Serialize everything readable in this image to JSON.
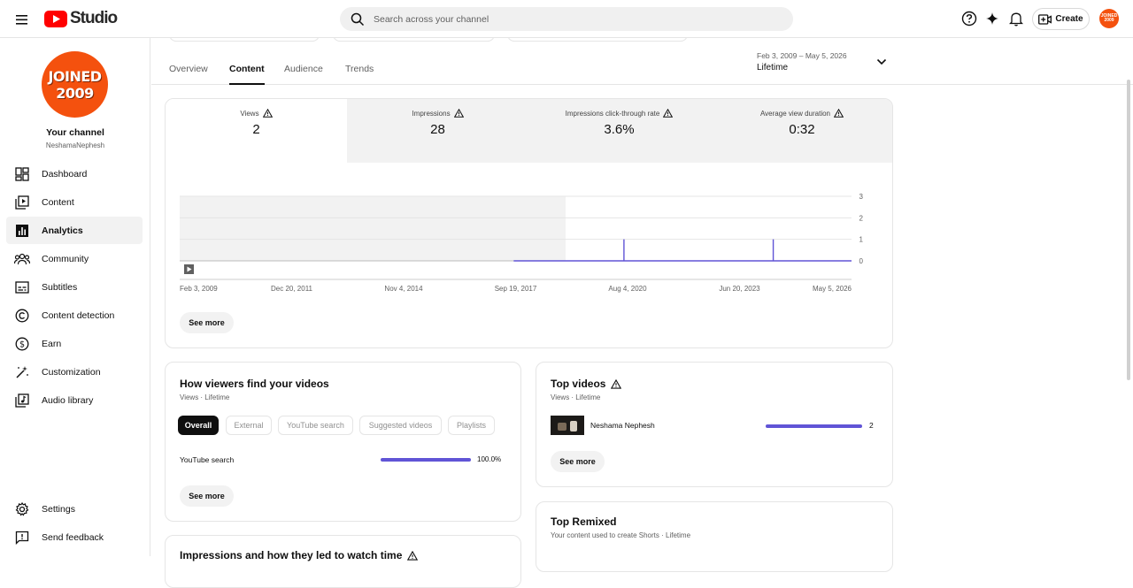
{
  "topbar": {
    "logo_text": "Studio",
    "search_placeholder": "Search across your channel",
    "create_label": "Create",
    "avatar_text": "JOINED 2009"
  },
  "sidebar": {
    "avatar_line1": "JOINED",
    "avatar_line2": "2009",
    "channel_title": "Your channel",
    "channel_handle": "NeshamaNephesh",
    "items": [
      {
        "label": "Dashboard",
        "icon": "dashboard-icon"
      },
      {
        "label": "Content",
        "icon": "content-icon"
      },
      {
        "label": "Analytics",
        "icon": "analytics-icon"
      },
      {
        "label": "Community",
        "icon": "community-icon"
      },
      {
        "label": "Subtitles",
        "icon": "subtitles-icon"
      },
      {
        "label": "Content detection",
        "icon": "copyright-icon"
      },
      {
        "label": "Earn",
        "icon": "dollar-icon"
      },
      {
        "label": "Customization",
        "icon": "magic-wand-icon"
      },
      {
        "label": "Audio library",
        "icon": "audio-library-icon"
      }
    ],
    "bottom": [
      {
        "label": "Settings",
        "icon": "gear-icon"
      },
      {
        "label": "Send feedback",
        "icon": "feedback-icon"
      }
    ],
    "active_item": "Analytics"
  },
  "tabs": {
    "items": [
      "Overview",
      "Content",
      "Audience",
      "Trends"
    ],
    "active": "Content"
  },
  "date_picker": {
    "range": "Feb 3, 2009 – May 5, 2026",
    "label": "Lifetime"
  },
  "metrics": [
    {
      "label": "Views",
      "value": "2"
    },
    {
      "label": "Impressions",
      "value": "28"
    },
    {
      "label": "Impressions click-through rate",
      "value": "3.6%"
    },
    {
      "label": "Average view duration",
      "value": "0:32"
    }
  ],
  "chart_data": {
    "type": "line",
    "x_ticks": [
      "Feb 3, 2009",
      "Dec 20, 2011",
      "Nov 4, 2014",
      "Sep 19, 2017",
      "Aug 4, 2020",
      "Jun 20, 2023",
      "May 5, 2026"
    ],
    "y_ticks": [
      "3",
      "2",
      "1",
      "0"
    ],
    "ylim": [
      0,
      3
    ],
    "series": [
      {
        "values": [
          {
            "x": "Jun 2015",
            "y": 0
          },
          {
            "x": "Jun 2020",
            "y": 1
          },
          {
            "x": "Jun 2024",
            "y": 1
          },
          {
            "x": "May 5, 2026",
            "y": 0
          }
        ]
      }
    ],
    "shaded_range_end": "Sep 2017",
    "line_color": "#6054d6",
    "grid": true
  },
  "main_card": {
    "see_more": "See more"
  },
  "find_card": {
    "title": "How viewers find your videos",
    "subtitle": "Views · Lifetime",
    "chips": [
      "Overall",
      "External",
      "YouTube search",
      "Suggested videos",
      "Playlists"
    ],
    "active_chip": "Overall",
    "rows": [
      {
        "label": "YouTube search",
        "value": "100.0%",
        "fraction": 1.0
      }
    ],
    "see_more": "See more"
  },
  "top_videos": {
    "title": "Top videos",
    "subtitle": "Views · Lifetime",
    "rows": [
      {
        "title": "Neshama Nephesh",
        "value": "2",
        "fraction": 1.0
      }
    ],
    "see_more": "See more"
  },
  "top_remixed": {
    "title": "Top Remixed",
    "subtitle": "Your content used to create Shorts · Lifetime"
  },
  "impressions_card": {
    "title": "Impressions and how they led to watch time"
  }
}
